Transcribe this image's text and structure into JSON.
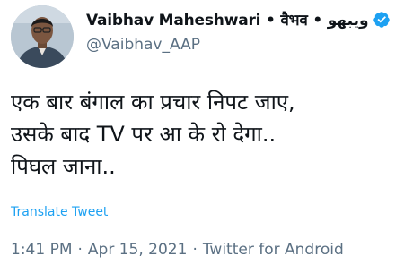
{
  "author": {
    "display_name": "Vaibhav Maheshwari • वैभव • ویبھو",
    "handle": "@Vaibhav_AAP",
    "verified_icon": "verified-badge-icon",
    "avatar_icon": "profile-photo"
  },
  "tweet": {
    "lines": [
      "एक बार बंगाल का प्रचार निपट जाए,",
      "उसके बाद TV पर आ के रो देगा..",
      "पिघल जाना.."
    ],
    "translate_label": "Translate Tweet"
  },
  "meta": {
    "time": "1:41 PM",
    "separator": "·",
    "date": "Apr 15, 2021",
    "source": "Twitter for Android"
  },
  "colors": {
    "accent": "#1da1f2",
    "secondary_text": "#5b7083",
    "primary_text": "#0f1419"
  }
}
